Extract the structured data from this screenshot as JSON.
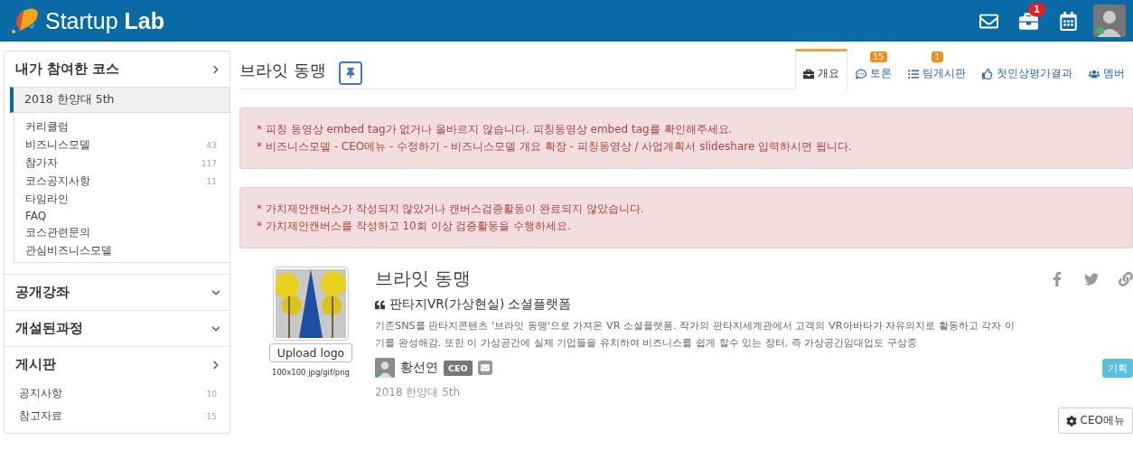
{
  "header": {
    "logo": "Startup **Lab**",
    "notifications": [
      {
        "kind": "mail"
      },
      {
        "kind": "briefcase",
        "badge": "1"
      },
      {
        "kind": "calendar"
      }
    ]
  },
  "sidebar": {
    "sections": [
      {
        "title": "내가 참여한 코스",
        "expanded": true,
        "course": {
          "name": "2018 한양대 5th",
          "selected": true
        },
        "items": [
          {
            "label": "커리큘럼"
          },
          {
            "label": "비즈니스모델",
            "count": "43"
          },
          {
            "label": "참가자",
            "count": "117"
          },
          {
            "label": "코스공지사항",
            "count": "11"
          },
          {
            "label": "타임라인"
          },
          {
            "label": "FAQ"
          },
          {
            "label": "코스관련문의"
          },
          {
            "label": "관심비즈니스모델"
          }
        ]
      },
      {
        "title": "공개강좌",
        "expanded": false
      },
      {
        "title": "개설된과정",
        "expanded": false
      },
      {
        "title": "게시판",
        "expanded": true,
        "items": [
          {
            "label": "공지사항",
            "count": "10"
          },
          {
            "label": "참고자료",
            "count": "15"
          }
        ]
      }
    ]
  },
  "page": {
    "title": "브라잇 동맹",
    "tabs": [
      {
        "label": "개요",
        "selected": true
      },
      {
        "label": "토론",
        "badge": "15",
        "selected": false
      },
      {
        "label": "팀게시판",
        "badge": "1",
        "selected": false
      },
      {
        "label": "첫인상평가결과",
        "selected": false
      },
      {
        "label": "멤버",
        "selected": false
      }
    ],
    "alerts": [
      [
        "* 피칭 동영상 embed tag가 없거나 올바르지 않습니다. 피칭동영상 embed tag를 확인해주세요.",
        "* 비즈니스모델 - CEO메뉴 - 수정하기 - 비즈니스모델 개요 확장 - 피칭동영상 / 사업계획서 slideshare 입력하시면 됩니다."
      ],
      [
        "* 가치제안캔버스가 작성되지 않았거나 캔버스검증활동이 완료되지 않았습니다.",
        "* 가치제안캔버스를 작성하고 10회 이상 검증활동을 수행하세요."
      ]
    ],
    "project": {
      "logo": {
        "kind": "picture"
      },
      "upload_button": "Upload logo",
      "upload_hint": "100x100 jpg/gif/png",
      "name": "브라잇 동맹",
      "tagline": "판타지VR(가상현실) 소셜플랫폼",
      "description": [
        "기존SNS를 판타지콘텐츠 '브라잇 동맹'으로 가져온 VR 소셜플랫폼. 작가의 판타지세계관에서 고객의 VR아바타가 자유의지로 활동하고 각자 이",
        "기를 완성해감. 또한 이 가상공간에 실제 기업들을 유치하여 비즈니스를 쉽게 할수 있는 장터, 즉 가상공간임대업도 구상중"
      ],
      "author": "황선연",
      "role": "CEO",
      "course": "2018 한양대 5th",
      "tag": "기획",
      "menu_button": "CEO메뉴"
    }
  }
}
